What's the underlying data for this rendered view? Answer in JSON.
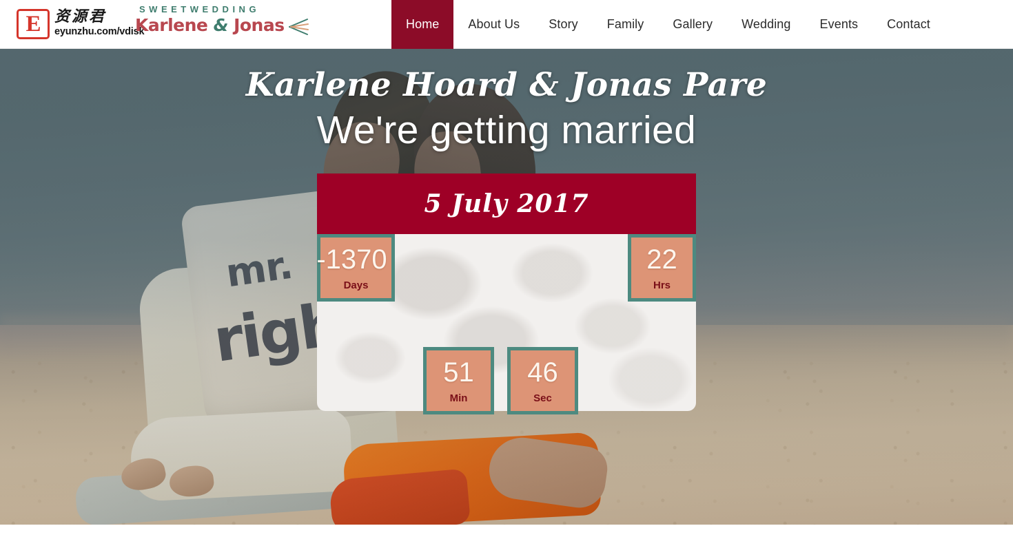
{
  "watermark": {
    "badge_letter": "E",
    "cn_text": "资源君",
    "url": "eyunzhu.com/vdisk"
  },
  "logo": {
    "tagline": "SWEETWEDDING",
    "name_left": "Karlene ",
    "amp": "&",
    "name_right": " Jonas"
  },
  "nav": {
    "items": [
      {
        "label": "Home",
        "active": true
      },
      {
        "label": "About Us",
        "active": false
      },
      {
        "label": "Story",
        "active": false
      },
      {
        "label": "Family",
        "active": false
      },
      {
        "label": "Gallery",
        "active": false
      },
      {
        "label": "Wedding",
        "active": false
      },
      {
        "label": "Events",
        "active": false
      },
      {
        "label": "Contact",
        "active": false
      }
    ],
    "active_bg": "#8c0c28"
  },
  "hero": {
    "couple_names": "Karlene Hoard & Jonas Pare",
    "tagline": "We're getting married",
    "pillow_text_line1": "mr.",
    "pillow_text_line2": "right"
  },
  "countdown": {
    "date_label": "5 July 2017",
    "banner_color": "#9e0026",
    "box_border_color": "#4d8a80",
    "box_fill_color": "#dd9476",
    "label_color": "#7a0f18",
    "units": [
      {
        "key": "days",
        "value": "-1370",
        "label": "Days"
      },
      {
        "key": "hrs",
        "value": "22",
        "label": "Hrs"
      },
      {
        "key": "min",
        "value": "51",
        "label": "Min"
      },
      {
        "key": "sec",
        "value": "46",
        "label": "Sec"
      }
    ]
  }
}
